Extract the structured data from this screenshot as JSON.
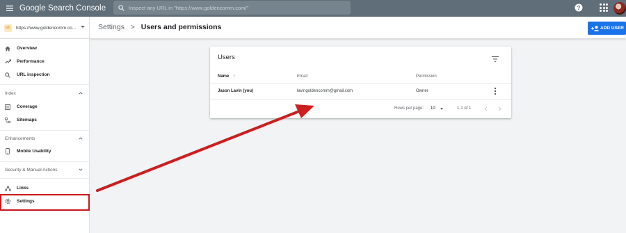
{
  "app": {
    "brand": "Google Search Console",
    "search_placeholder": "Inspect any URL in \"https://www.goldencomm.com/\""
  },
  "property": {
    "logo_text": "GC",
    "url": "https://www.goldencomm.co..."
  },
  "breadcrumb": {
    "parent": "Settings",
    "separator": ">",
    "current": "Users and permissions"
  },
  "add_user": {
    "label": "ADD USER"
  },
  "sidebar": {
    "items_top": [
      {
        "label": "Overview",
        "icon": "home-icon"
      },
      {
        "label": "Performance",
        "icon": "trending-up-icon"
      },
      {
        "label": "URL inspection",
        "icon": "search-icon"
      }
    ],
    "sections": [
      {
        "label": "Index",
        "items": [
          {
            "label": "Coverage",
            "icon": "coverage-icon"
          },
          {
            "label": "Sitemaps",
            "icon": "sitemap-icon"
          }
        ]
      },
      {
        "label": "Enhancements",
        "items": [
          {
            "label": "Mobile Usability",
            "icon": "phone-icon"
          }
        ]
      },
      {
        "label": "Security & Manual Actions",
        "items": []
      }
    ],
    "items_bottom": [
      {
        "label": "Links",
        "icon": "links-icon"
      },
      {
        "label": "Settings",
        "icon": "gear-icon"
      }
    ]
  },
  "users_card": {
    "title": "Users",
    "columns": {
      "name": "Name",
      "email": "Email",
      "permission": "Permission"
    },
    "sort_indicator": "↑",
    "rows": [
      {
        "name": "Jason Lavin (you)",
        "email": "lavingoldencomm@gmail.com",
        "permission": "Owner"
      }
    ],
    "footer": {
      "rows_per_page_label": "Rows per page:",
      "rows_per_page_value": "10",
      "range": "1-1 of 1"
    }
  },
  "colors": {
    "topbar": "#5f6e78",
    "accent": "#1a73e8",
    "highlight": "#c8181e"
  }
}
